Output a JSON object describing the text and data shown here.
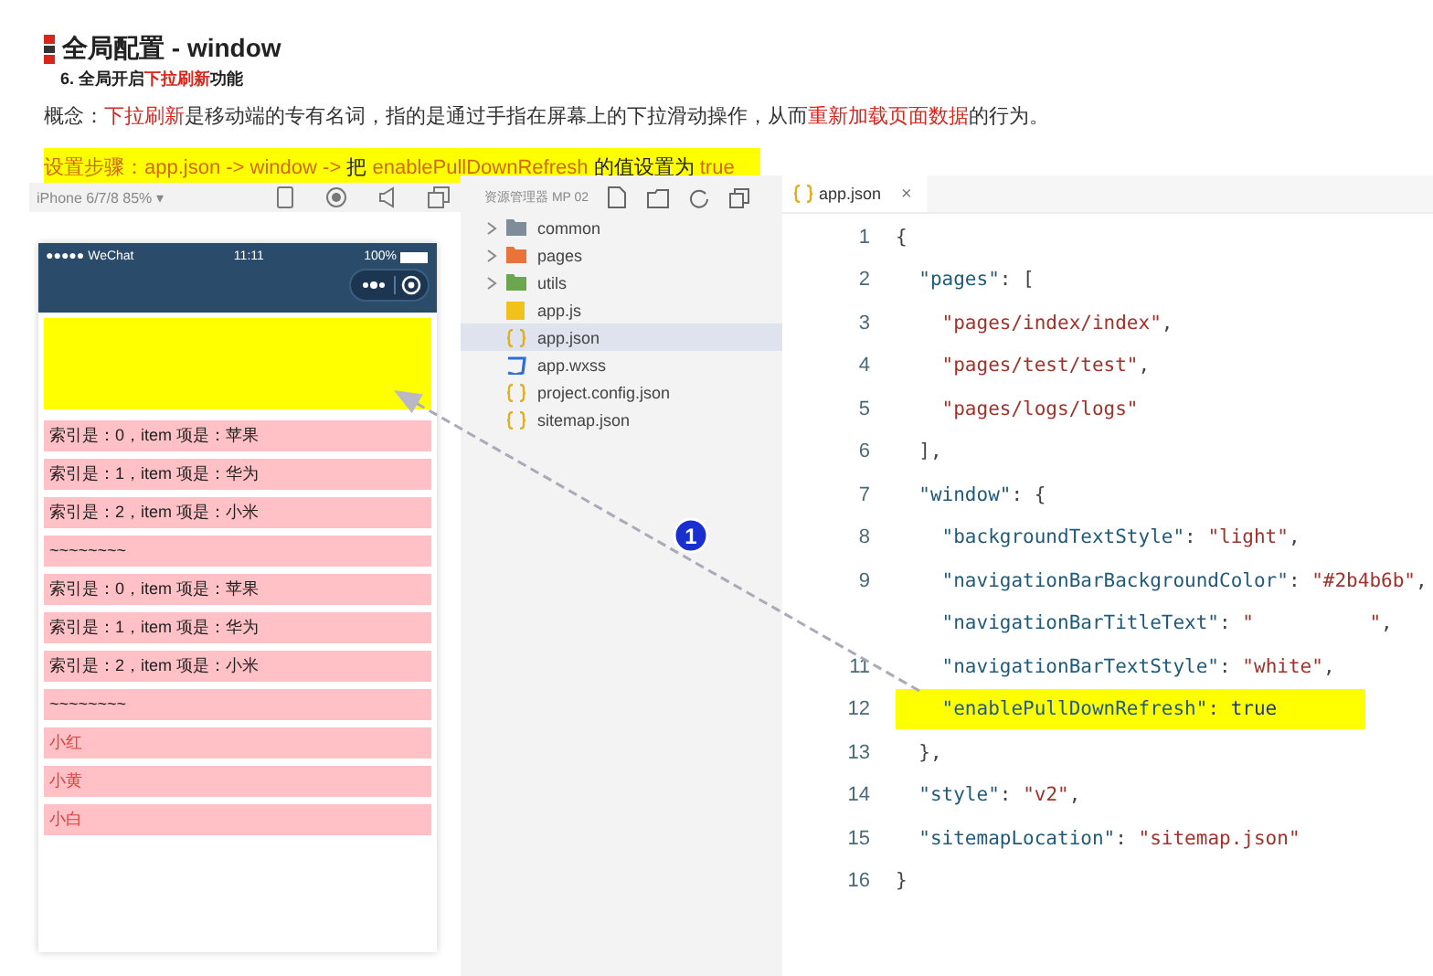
{
  "heading": {
    "title": "全局配置 - window",
    "subtitle": [
      {
        "text": "6. 全局开启",
        "emphasis": false
      },
      {
        "text": "下拉刷新",
        "emphasis": true
      },
      {
        "text": "功能",
        "emphasis": false
      }
    ],
    "concept": [
      {
        "text": "概念：",
        "emphasis": false
      },
      {
        "text": "下拉刷新",
        "emphasis": true
      },
      {
        "text": "是移动端的专有名词，指的是通过手指在屏幕上的下拉滑动操作，从而",
        "emphasis": false
      },
      {
        "text": "重新加载页面数据",
        "emphasis": true
      },
      {
        "text": "的行为。",
        "emphasis": false
      }
    ],
    "steps": [
      {
        "text": "设置步骤：app.json -> window -> ",
        "emphasis": true
      },
      {
        "text": "把 ",
        "emphasis": false
      },
      {
        "text": "enablePullDownRefresh",
        "emphasis": true
      },
      {
        "text": " 的值设置为 ",
        "emphasis": false
      },
      {
        "text": "true",
        "emphasis": true
      }
    ]
  },
  "simulator": {
    "device": "iPhone 6/7/8 85% ▾",
    "status_bar": {
      "carrier": "●●●●● WeChat",
      "time": "11:11",
      "battery": "100%"
    },
    "items": [
      {
        "text": "索引是：0，item 项是：苹果",
        "kind": "plain"
      },
      {
        "text": "索引是：1，item 项是：华为",
        "kind": "plain"
      },
      {
        "text": "索引是：2，item 项是：小米",
        "kind": "plain"
      },
      {
        "text": "~~~~~~~~",
        "kind": "plain"
      },
      {
        "text": "索引是：0，item 项是：苹果",
        "kind": "plain"
      },
      {
        "text": "索引是：1，item 项是：华为",
        "kind": "plain"
      },
      {
        "text": "索引是：2，item 项是：小米",
        "kind": "plain"
      },
      {
        "text": "~~~~~~~~",
        "kind": "plain"
      },
      {
        "text": "小红",
        "kind": "red"
      },
      {
        "text": "小黄",
        "kind": "red"
      },
      {
        "text": "小白",
        "kind": "red"
      }
    ]
  },
  "explorer": {
    "title": "资源管理器 MP 02",
    "items": [
      {
        "name": "common",
        "kind": "folder",
        "color": "#7f8c9a",
        "selected": false
      },
      {
        "name": "pages",
        "kind": "folder",
        "color": "#e8743b",
        "selected": false
      },
      {
        "name": "utils",
        "kind": "folder",
        "color": "#6aa84f",
        "selected": false
      },
      {
        "name": "app.js",
        "kind": "js",
        "color": "#f2c11b",
        "selected": false
      },
      {
        "name": "app.json",
        "kind": "json",
        "color": "#e0b020",
        "selected": true
      },
      {
        "name": "app.wxss",
        "kind": "css",
        "color": "#2d6fd8",
        "selected": false
      },
      {
        "name": "project.config.json",
        "kind": "json",
        "color": "#e0b020",
        "selected": false
      },
      {
        "name": "sitemap.json",
        "kind": "json",
        "color": "#e0b020",
        "selected": false
      }
    ]
  },
  "editor": {
    "tab": "app.json",
    "close": "×",
    "lines": [
      {
        "number": "1",
        "highlighted": false,
        "segments": [
          {
            "kind": "punct",
            "text": "{"
          }
        ]
      },
      {
        "number": "2",
        "highlighted": false,
        "segments": [
          {
            "kind": "key",
            "text": "  \"pages\""
          },
          {
            "kind": "punct",
            "text": ": ["
          }
        ]
      },
      {
        "number": "3",
        "highlighted": false,
        "segments": [
          {
            "kind": "string",
            "text": "    \"pages/index/index\""
          },
          {
            "kind": "punct",
            "text": ","
          }
        ]
      },
      {
        "number": "4",
        "highlighted": false,
        "segments": [
          {
            "kind": "string",
            "text": "    \"pages/test/test\""
          },
          {
            "kind": "punct",
            "text": ","
          }
        ]
      },
      {
        "number": "5",
        "highlighted": false,
        "segments": [
          {
            "kind": "string",
            "text": "    \"pages/logs/logs\""
          }
        ]
      },
      {
        "number": "6",
        "highlighted": false,
        "segments": [
          {
            "kind": "punct",
            "text": "  ],"
          }
        ]
      },
      {
        "number": "7",
        "highlighted": false,
        "segments": [
          {
            "kind": "key",
            "text": "  \"window\""
          },
          {
            "kind": "punct",
            "text": ": {"
          }
        ]
      },
      {
        "number": "8",
        "highlighted": false,
        "segments": [
          {
            "kind": "key",
            "text": "    \"backgroundTextStyle\""
          },
          {
            "kind": "punct",
            "text": ": "
          },
          {
            "kind": "string",
            "text": "\"light\""
          },
          {
            "kind": "punct",
            "text": ","
          }
        ]
      },
      {
        "number": "9",
        "highlighted": false,
        "segments": [
          {
            "kind": "key",
            "text": "    \"navigationBarBackgroundColor\""
          },
          {
            "kind": "punct",
            "text": ": "
          },
          {
            "kind": "string",
            "text": "\"#2b4b6b\""
          },
          {
            "kind": "punct",
            "text": ","
          }
        ]
      },
      {
        "highlighted": false,
        "segments": [
          {
            "kind": "key",
            "text": "    \"navigationBarTitleText\""
          },
          {
            "kind": "punct",
            "text": ": "
          },
          {
            "kind": "string",
            "text": "\"          \""
          },
          {
            "kind": "punct",
            "text": ","
          }
        ]
      },
      {
        "number": "11",
        "highlighted": false,
        "segments": [
          {
            "kind": "key",
            "text": "    \"navigationBarTextStyle\""
          },
          {
            "kind": "punct",
            "text": ": "
          },
          {
            "kind": "string",
            "text": "\"white\""
          },
          {
            "kind": "punct",
            "text": ","
          }
        ]
      },
      {
        "number": "12",
        "highlighted": true,
        "segments": [
          {
            "kind": "key",
            "text": "    \"enablePullDownRefresh\""
          },
          {
            "kind": "punct",
            "text": ": "
          },
          {
            "kind": "bool",
            "text": "true"
          }
        ]
      },
      {
        "number": "13",
        "highlighted": false,
        "segments": [
          {
            "kind": "punct",
            "text": "  },"
          }
        ]
      },
      {
        "number": "14",
        "highlighted": false,
        "segments": [
          {
            "kind": "key",
            "text": "  \"style\""
          },
          {
            "kind": "punct",
            "text": ": "
          },
          {
            "kind": "string",
            "text": "\"v2\""
          },
          {
            "kind": "punct",
            "text": ","
          }
        ]
      },
      {
        "number": "15",
        "highlighted": false,
        "segments": [
          {
            "kind": "key",
            "text": "  \"sitemapLocation\""
          },
          {
            "kind": "punct",
            "text": ": "
          },
          {
            "kind": "string",
            "text": "\"sitemap.json\""
          }
        ]
      },
      {
        "number": "16",
        "highlighted": false,
        "segments": [
          {
            "kind": "punct",
            "text": "}"
          }
        ]
      }
    ]
  },
  "annotation": {
    "label": "1"
  }
}
